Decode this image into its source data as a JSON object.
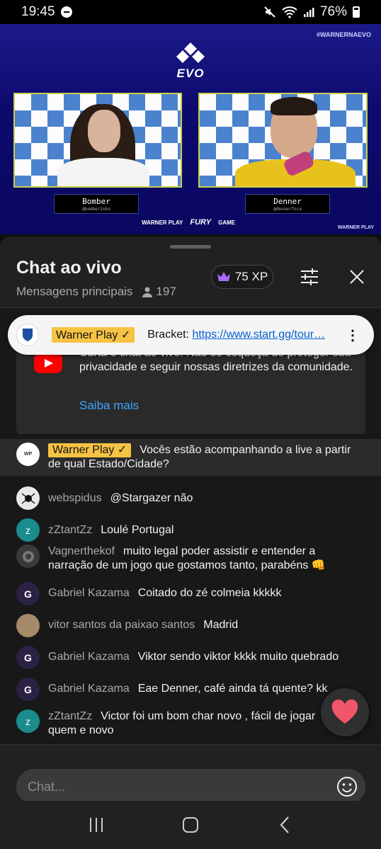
{
  "status_bar": {
    "time": "19:45",
    "battery": "76%"
  },
  "video": {
    "hashtag": "#WARNERNAEVO",
    "event_logo_text": "EVO",
    "left_player": {
      "name": "Bomber",
      "handle": "@bomber2xko"
    },
    "right_player": {
      "name": "Denner",
      "handle": "@dennerfoca"
    },
    "sponsors": [
      "WARNER PLAY",
      "FURY",
      "GAME"
    ],
    "corner_logo": "WARNER PLAY"
  },
  "chat_header": {
    "title": "Chat ao vivo",
    "mode": "Mensagens principais",
    "viewer_count": "197",
    "xp_label": "75 XP"
  },
  "pinned": {
    "author_badge": "Warner Play",
    "text": "Bracket: ",
    "link": "https://www.start.gg/tour…"
  },
  "notice": {
    "text": "Curta o chat ao vivo! Não se esqueça de proteger sua privacidade e seguir nossas diretrizes da comunidade.",
    "link": "Saiba mais"
  },
  "messages": [
    {
      "author": "Warner Play",
      "text": "Vocês estão acompanhando a live a partir de qual Estado/Cidade?",
      "owner": true,
      "avatar": "WP",
      "avatar_color": "#ffffff"
    },
    {
      "author": "webspidus",
      "text": "@Stargazer não",
      "avatar": "",
      "avatar_color": "#e8e8e8"
    },
    {
      "author": "zZtantZz",
      "text": "Loulé Portugal",
      "avatar": "z",
      "avatar_color": "#1a8c8c"
    },
    {
      "author": "Vagnerthekof",
      "text": "muito legal poder assistir e entender a narração de um jogo que gostamos tanto, parabéns 👊",
      "avatar": "",
      "avatar_color": "#3a3a3a"
    },
    {
      "author": "Gabriel Kazama",
      "text": "Coitado do zé colmeia kkkkk",
      "avatar": "G",
      "avatar_color": "#2b2244"
    },
    {
      "author": "vitor santos da paixao santos",
      "text": "Madrid",
      "avatar": "",
      "avatar_color": "#a58a6a"
    },
    {
      "author": "Gabriel Kazama",
      "text": "Viktor sendo viktor kkkk muito quebrado",
      "avatar": "G",
      "avatar_color": "#2b2244"
    },
    {
      "author": "Gabriel Kazama",
      "text": "Eae Denner, café ainda tá quente? kk",
      "avatar": "G",
      "avatar_color": "#2b2244"
    },
    {
      "author": "zZtantZz",
      "text": "Victor foi um bom char novo , fácil de jogar quem e novo",
      "avatar": "z",
      "avatar_color": "#1a8c8c"
    }
  ],
  "input": {
    "placeholder": "Chat..."
  },
  "colors": {
    "accent_link": "#3ea6ff",
    "owner_badge": "#f6c344",
    "video_bg": "#0d0a6e"
  }
}
